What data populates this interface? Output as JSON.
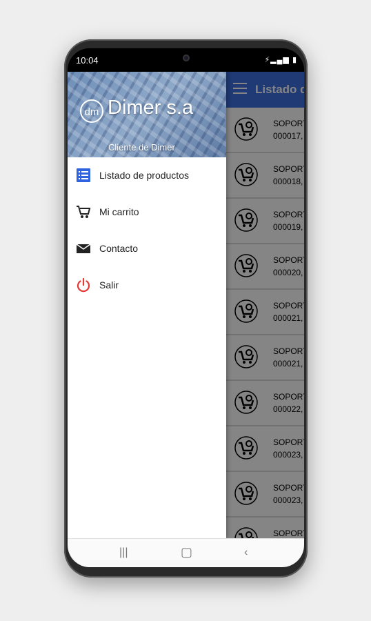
{
  "status_bar": {
    "time": "10:04"
  },
  "app_bar": {
    "title": "Listado d"
  },
  "drawer": {
    "logo_text": "dm",
    "brand": "Dimer s.a",
    "subtitle": "Cliente de Dimer",
    "items": [
      {
        "label": "Listado de productos",
        "icon": "list-icon"
      },
      {
        "label": "Mi carrito",
        "icon": "cart-icon"
      },
      {
        "label": "Contacto",
        "icon": "mail-icon"
      },
      {
        "label": "Salir",
        "icon": "power-icon"
      }
    ]
  },
  "products": [
    {
      "name": "SOPORT",
      "code": "000017,"
    },
    {
      "name": "SOPORT",
      "code": "000018,"
    },
    {
      "name": "SOPORT",
      "code": "000019,"
    },
    {
      "name": "SOPORT",
      "code": "000020,"
    },
    {
      "name": "SOPORT",
      "code": "000021,"
    },
    {
      "name": "SOPORT",
      "code": "000021,"
    },
    {
      "name": "SOPORT",
      "code": "000022,"
    },
    {
      "name": "SOPORT",
      "code": "000023,"
    },
    {
      "name": "SOPORT",
      "code": "000023,"
    },
    {
      "name": "SOPORT",
      "code": ""
    }
  ],
  "colors": {
    "accent": "#3d6fe0",
    "list_icon": "#2f63e0",
    "power_icon": "#e53935"
  }
}
